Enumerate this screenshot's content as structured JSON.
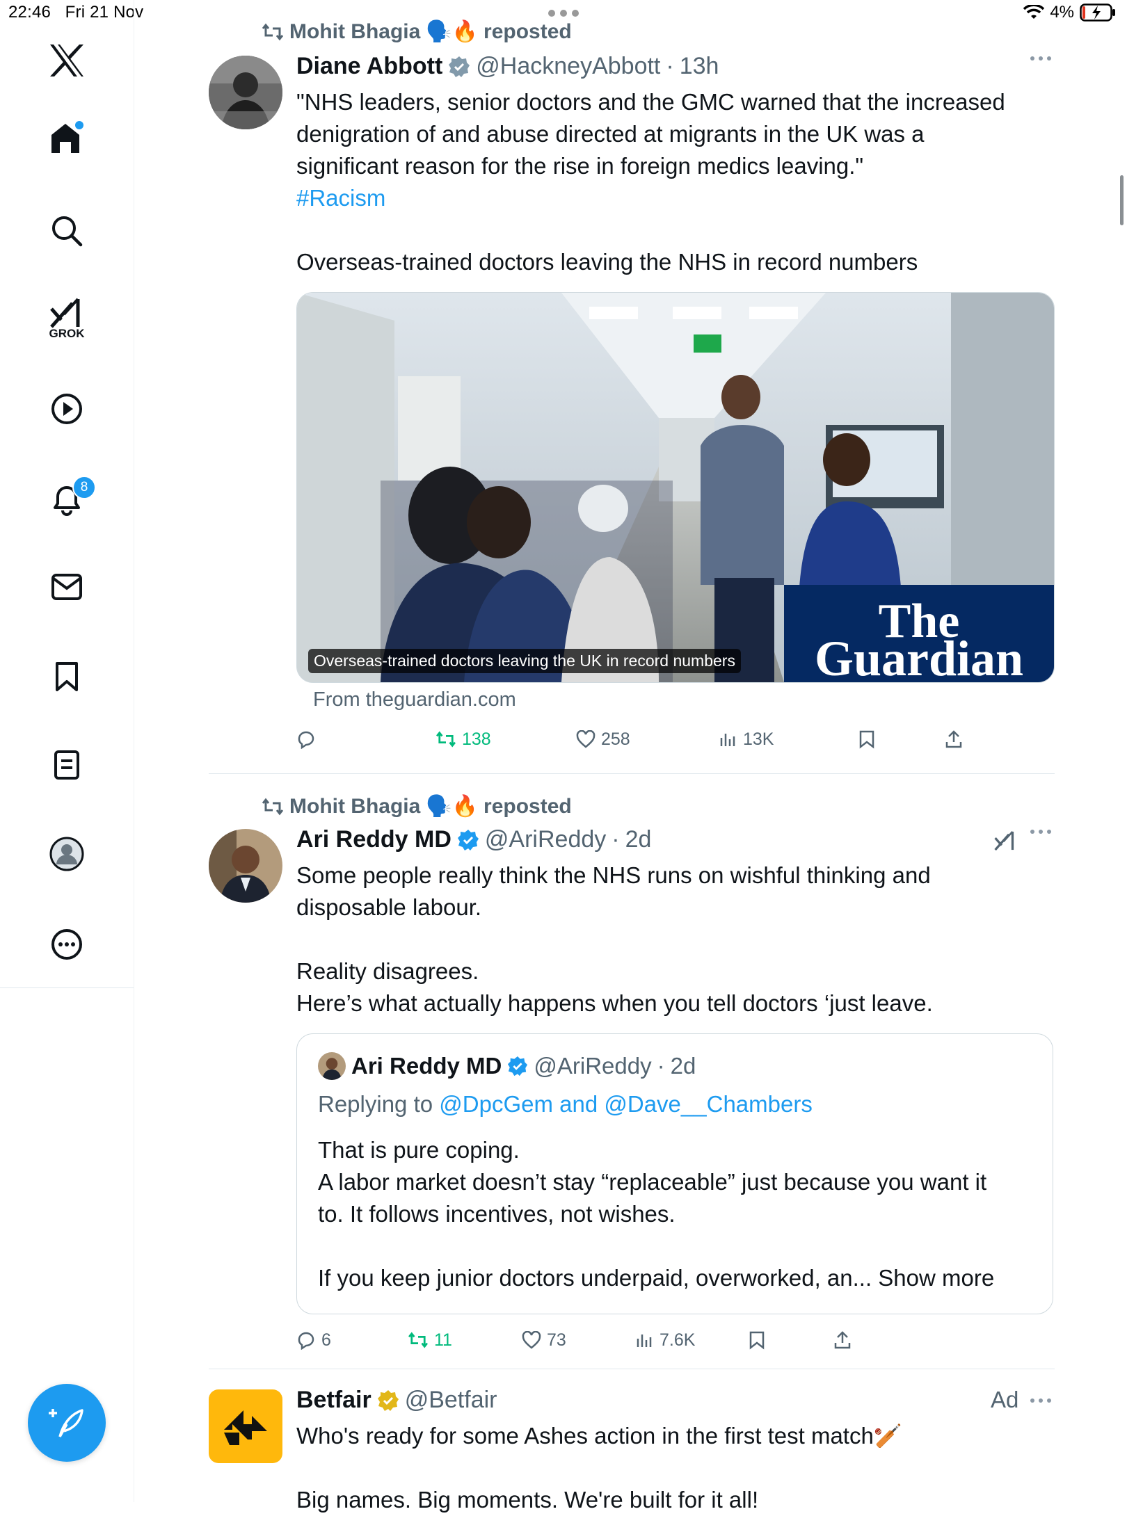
{
  "status_bar": {
    "time": "22:46",
    "date": "Fri 21 Nov",
    "battery": "4%"
  },
  "sidebar": {
    "notifications_badge": "8",
    "grok_label": "GROK"
  },
  "tweets": [
    {
      "repost_by": "Mohit Bhagia",
      "repost_emojis": "🗣️🔥",
      "repost_label": "reposted",
      "author_name": "Diane Abbott",
      "author_handle": "@HackneyAbbott",
      "time": "13h",
      "text_line1": "\"NHS leaders, senior doctors and the GMC warned that the increased",
      "text_line2": "denigration of and abuse directed at migrants in the UK was a",
      "text_line3": "significant reason for the rise in foreign medics leaving.\"",
      "hashtag": "#Racism",
      "text_line4": "Overseas-trained doctors leaving the NHS in record numbers",
      "card_caption": "Overseas-trained doctors leaving the UK in record numbers",
      "card_brand_1": "The",
      "card_brand_2": "Guardian",
      "card_source": "From theguardian.com",
      "replies": "",
      "reposts": "138",
      "likes": "258",
      "views": "13K"
    },
    {
      "repost_by": "Mohit Bhagia",
      "repost_emojis": "🗣️🔥",
      "repost_label": "reposted",
      "author_name": "Ari Reddy MD",
      "author_handle": "@AriReddy",
      "time": "2d",
      "text_line1": "Some people really think the NHS runs on wishful thinking and",
      "text_line2": "disposable labour.",
      "text_line3": "Reality disagrees.",
      "text_line4": "Here’s what actually happens when you tell doctors ‘just leave.",
      "quote": {
        "author_name": "Ari Reddy MD",
        "author_handle": "@AriReddy",
        "time": "2d",
        "replying_to_label": "Replying to",
        "replying_to": "@DpcGem and @Dave__Chambers",
        "line1": "That is pure coping.",
        "line2": "A labor market doesn’t stay “replaceable” just because you want it",
        "line3": "to. It follows incentives, not wishes.",
        "line4": "If you keep junior doctors underpaid, overworked, an...",
        "show_more": "Show more"
      },
      "replies": "6",
      "reposts": "11",
      "likes": "73",
      "views": "7.6K"
    },
    {
      "author_name": "Betfair",
      "author_handle": "@Betfair",
      "ad_label": "Ad",
      "text_line1": "Who's ready for some Ashes action in the first test match🏏",
      "text_line2": "Big names. Big moments. We're built for it all!"
    }
  ],
  "colors": {
    "accent": "#1d9bf0",
    "repost_green": "#00ba7c",
    "muted": "#536471",
    "guardian_blue": "#052962",
    "betfair_yellow": "#ffb80c"
  }
}
